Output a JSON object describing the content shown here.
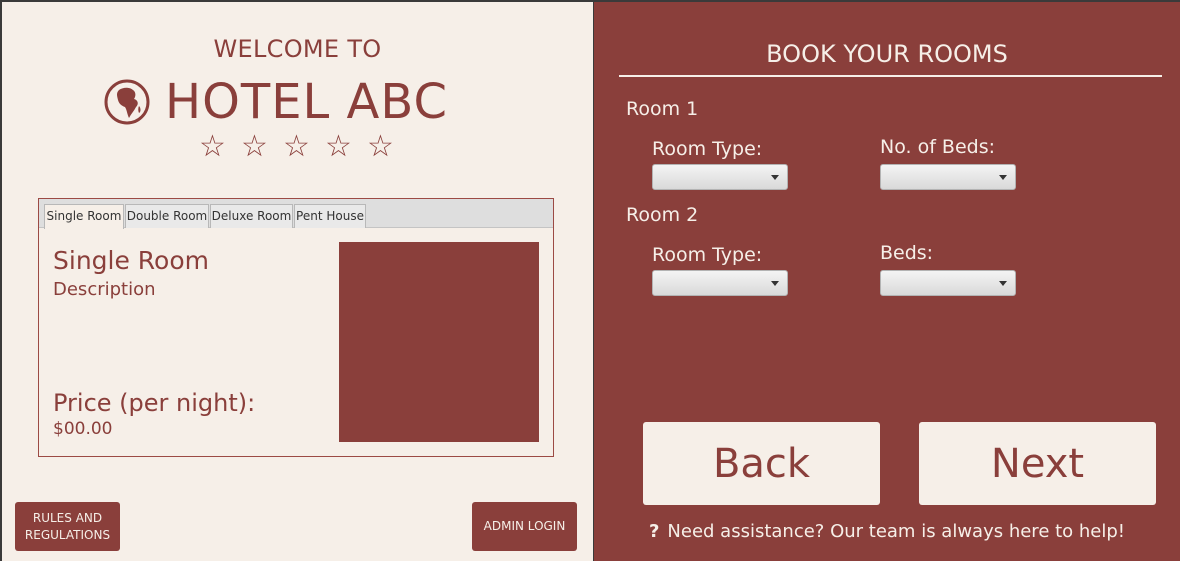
{
  "left": {
    "welcome": "WELCOME TO",
    "hotel_name": "HOTEL ABC",
    "stars": [
      "☆",
      "☆",
      "☆",
      "☆",
      "☆"
    ],
    "tabs": [
      "Single Room",
      "Double Room",
      "Deluxe Room",
      "Pent House"
    ],
    "active_tab": "Single Room",
    "room_title": "Single Room",
    "room_desc": "Description",
    "price_label": "Price (per night):",
    "price_value": "$00.00",
    "rules_button": "RULES AND\nREGULATIONS",
    "admin_button": "ADMIN LOGIN"
  },
  "right": {
    "title": "BOOK YOUR ROOMS",
    "room1": {
      "header": "Room 1",
      "type_label": "Room Type:",
      "beds_label": "No. of Beds:",
      "type_value": "",
      "beds_value": ""
    },
    "room2": {
      "header": "Room 2",
      "type_label": "Room Type:",
      "beds_label": "Beds:",
      "type_value": "",
      "beds_value": ""
    },
    "back_button": "Back",
    "next_button": "Next",
    "help_icon": "?",
    "help_text": "Need assistance? Our team is always here to help!"
  },
  "colors": {
    "brand": "#8a3f3b",
    "cream": "#f6efe8"
  },
  "icons": {
    "logo": "globe-africa-icon",
    "help": "question-icon"
  }
}
